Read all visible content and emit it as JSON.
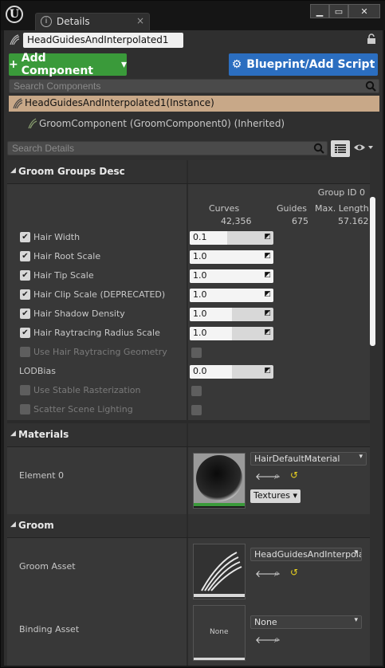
{
  "window": {
    "tab_title": "Details",
    "tab_close": "×",
    "minimize": "▁",
    "maximize": "▭",
    "close": "✕",
    "logo": "U"
  },
  "actor": {
    "name": "HeadGuidesAndInterpolated1",
    "icon": "groom-icon",
    "lock": "lock-icon"
  },
  "toolbar": {
    "add_component": "Add Component",
    "add_plus": "+",
    "add_chevron": "▾",
    "blueprint_script": "Blueprint/Add Script",
    "bp_icon": "⚙"
  },
  "components_search": {
    "placeholder": "Search Components"
  },
  "components": [
    {
      "label": "HeadGuidesAndInterpolated1(Instance)"
    },
    {
      "label": "GroomComponent (GroomComponent0) (Inherited)"
    }
  ],
  "details_search": {
    "placeholder": "Search Details"
  },
  "categories": {
    "groom_groups": "Groom Groups Desc",
    "materials": "Materials",
    "groom": "Groom"
  },
  "group_info": {
    "group_id": "Group ID 0",
    "headers": [
      "Curves",
      "Guides",
      "Max. Length"
    ],
    "values": [
      "42,356",
      "675",
      "57.162"
    ]
  },
  "properties": [
    {
      "label": "Hair Width",
      "checked": true,
      "value": "0.1",
      "fill": 0.45
    },
    {
      "label": "Hair Root Scale",
      "checked": true,
      "value": "1.0",
      "fill": 1.0
    },
    {
      "label": "Hair Tip Scale",
      "checked": true,
      "value": "1.0",
      "fill": 1.0
    },
    {
      "label": "Hair Clip Scale (DEPRECATED)",
      "checked": true,
      "value": "1.0",
      "fill": 1.0
    },
    {
      "label": "Hair Shadow Density",
      "checked": true,
      "value": "1.0",
      "fill": 0.5
    },
    {
      "label": "Hair Raytracing Radius Scale",
      "checked": true,
      "value": "1.0",
      "fill": 0.5
    }
  ],
  "disabled_props": [
    {
      "label": "Use Hair Raytracing Geometry"
    },
    {
      "label": "Use Stable Rasterization"
    },
    {
      "label": "Scatter Scene Lighting"
    }
  ],
  "lod_bias": {
    "label": "LODBias",
    "value": "0.0",
    "fill": 0.5
  },
  "materials": {
    "element_label": "Element 0",
    "material_name": "HairDefaultMaterial",
    "textures_label": "Textures ▾"
  },
  "groom": {
    "groom_asset_label": "Groom Asset",
    "groom_asset_value": "HeadGuidesAndInterpolat",
    "binding_asset_label": "Binding Asset",
    "binding_asset_value": "None",
    "binding_thumb_text": "None"
  },
  "glyphs": {
    "check": "✔",
    "arrow_down": "▾",
    "cat_arrow": "◢",
    "drag": "◩",
    "browse": "⟵",
    "find": "⚲",
    "reset": "↺",
    "eye": "👁"
  },
  "colors": {
    "add_component": "#3a9a3a",
    "blueprint": "#2b6ec0",
    "selected_component": "#c8a888"
  }
}
